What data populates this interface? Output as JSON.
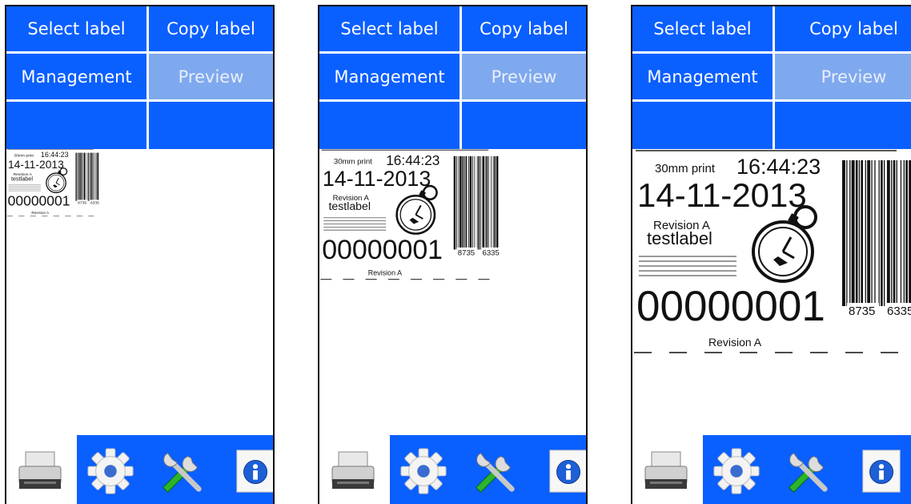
{
  "menu": {
    "select_label": "Select label",
    "copy_label": "Copy label",
    "management": "Management",
    "preview": "Preview"
  },
  "label": {
    "header_text": "30mm print",
    "time": "16:44:23",
    "date": "14-11-2013",
    "revision_small": "Revision A",
    "name": "testlabel",
    "counter": "00000001",
    "footer_revision": "Revision A",
    "barcode_left_digits": "8735",
    "barcode_right_digits": "6335"
  },
  "toolbar": {
    "icons": [
      "printer-icon",
      "gear-icon",
      "tools-icon",
      "info-icon"
    ]
  },
  "colors": {
    "accent": "#0a5fff",
    "disabled_tab": "#7fa9ee"
  },
  "zoom_levels": [
    0.35,
    0.7,
    1.0
  ]
}
